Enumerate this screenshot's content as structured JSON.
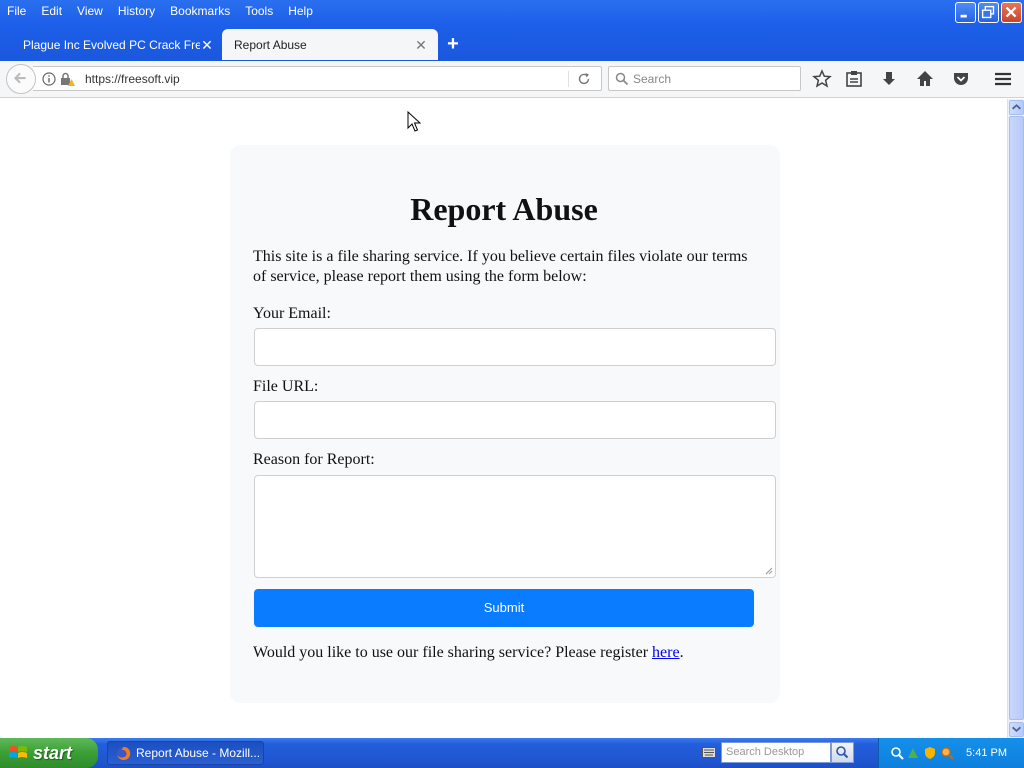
{
  "menu": [
    "File",
    "Edit",
    "View",
    "History",
    "Bookmarks",
    "Tools",
    "Help"
  ],
  "tabs": [
    {
      "title": "Plague Inc Evolved PC Crack Free ...",
      "active": false
    },
    {
      "title": "Report Abuse",
      "active": true
    }
  ],
  "nav": {
    "url": "https://freesoft.vip",
    "search_placeholder": "Search"
  },
  "page": {
    "heading": "Report Abuse",
    "intro": "This site is a file sharing service. If you believe certain files violate our terms of service, please report them using the form below:",
    "email_label": "Your Email:",
    "file_url_label": "File URL:",
    "reason_label": "Reason for Report:",
    "submit_label": "Submit",
    "footer_prefix": "Would you like to use our file sharing service? Please register ",
    "footer_link": "here",
    "footer_suffix": "."
  },
  "taskbar": {
    "start_label": "start",
    "task_label": "Report Abuse - Mozill...",
    "desktop_search_placeholder": "Search Desktop",
    "clock": "5:41 PM"
  },
  "colors": {
    "titlebar": "#1d5fe8",
    "submit": "#0a7cff",
    "card": "#f8f9fa",
    "link": "#0000ee"
  }
}
